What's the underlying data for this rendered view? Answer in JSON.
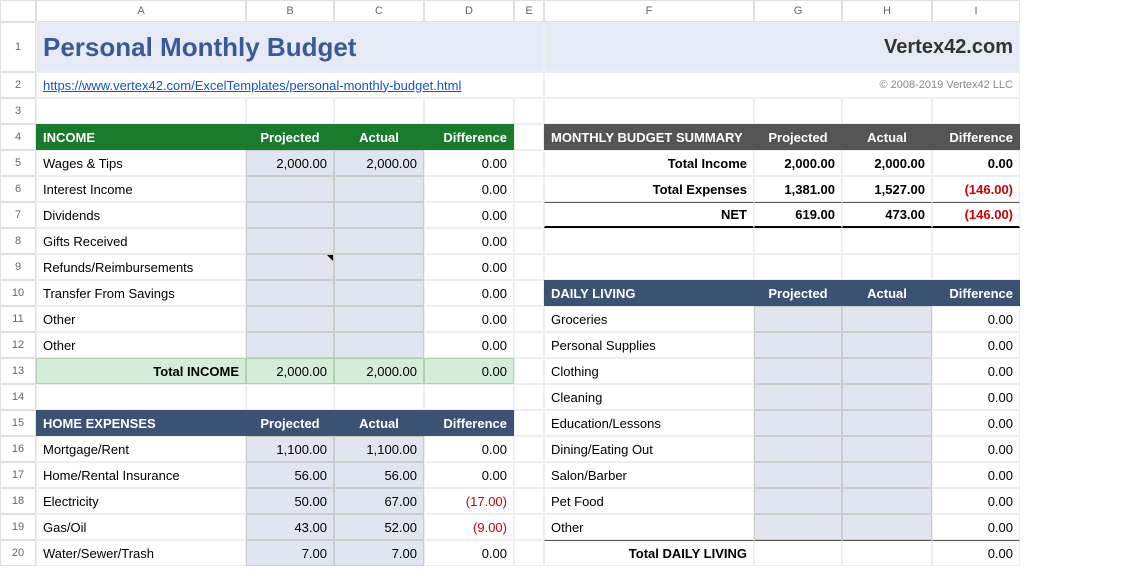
{
  "cols": [
    "A",
    "B",
    "C",
    "D",
    "E",
    "F",
    "G",
    "H",
    "I"
  ],
  "rows": [
    "1",
    "2",
    "3",
    "4",
    "5",
    "6",
    "7",
    "8",
    "9",
    "10",
    "11",
    "12",
    "13",
    "14",
    "15",
    "16",
    "17",
    "18",
    "19",
    "20"
  ],
  "title": "Personal Monthly Budget",
  "brand": "Vertex42.com",
  "link": "https://www.vertex42.com/ExcelTemplates/personal-monthly-budget.html",
  "copyright": "© 2008-2019 Vertex42 LLC",
  "headers": {
    "income": "INCOME",
    "projected": "Projected",
    "actual": "Actual",
    "difference": "Difference",
    "summary": "MONTHLY BUDGET SUMMARY",
    "home": "HOME EXPENSES",
    "daily": "DAILY LIVING"
  },
  "income": {
    "items": [
      {
        "label": "Wages & Tips",
        "proj": "2,000.00",
        "act": "2,000.00",
        "diff": "0.00"
      },
      {
        "label": "Interest Income",
        "proj": "",
        "act": "",
        "diff": "0.00"
      },
      {
        "label": "Dividends",
        "proj": "",
        "act": "",
        "diff": "0.00"
      },
      {
        "label": "Gifts Received",
        "proj": "",
        "act": "",
        "diff": "0.00"
      },
      {
        "label": "Refunds/Reimbursements",
        "proj": "",
        "act": "",
        "diff": "0.00"
      },
      {
        "label": "Transfer From Savings",
        "proj": "",
        "act": "",
        "diff": "0.00"
      },
      {
        "label": "Other",
        "proj": "",
        "act": "",
        "diff": "0.00"
      },
      {
        "label": "Other",
        "proj": "",
        "act": "",
        "diff": "0.00"
      }
    ],
    "total_label": "Total INCOME",
    "total_proj": "2,000.00",
    "total_act": "2,000.00",
    "total_diff": "0.00"
  },
  "summary": {
    "rows": [
      {
        "label": "Total Income",
        "proj": "2,000.00",
        "act": "2,000.00",
        "diff": "0.00",
        "neg": false
      },
      {
        "label": "Total Expenses",
        "proj": "1,381.00",
        "act": "1,527.00",
        "diff": "(146.00)",
        "neg": true
      },
      {
        "label": "NET",
        "proj": "619.00",
        "act": "473.00",
        "diff": "(146.00)",
        "neg": true
      }
    ]
  },
  "home": {
    "items": [
      {
        "label": "Mortgage/Rent",
        "proj": "1,100.00",
        "act": "1,100.00",
        "diff": "0.00",
        "neg": false
      },
      {
        "label": "Home/Rental Insurance",
        "proj": "56.00",
        "act": "56.00",
        "diff": "0.00",
        "neg": false
      },
      {
        "label": "Electricity",
        "proj": "50.00",
        "act": "67.00",
        "diff": "(17.00)",
        "neg": true
      },
      {
        "label": "Gas/Oil",
        "proj": "43.00",
        "act": "52.00",
        "diff": "(9.00)",
        "neg": true
      },
      {
        "label": "Water/Sewer/Trash",
        "proj": "7.00",
        "act": "7.00",
        "diff": "0.00",
        "neg": false
      }
    ]
  },
  "daily": {
    "items": [
      {
        "label": "Groceries",
        "diff": "0.00"
      },
      {
        "label": "Personal Supplies",
        "diff": "0.00"
      },
      {
        "label": "Clothing",
        "diff": "0.00"
      },
      {
        "label": "Cleaning",
        "diff": "0.00"
      },
      {
        "label": "Education/Lessons",
        "diff": "0.00"
      },
      {
        "label": "Dining/Eating Out",
        "diff": "0.00"
      },
      {
        "label": "Salon/Barber",
        "diff": "0.00"
      },
      {
        "label": "Pet Food",
        "diff": "0.00"
      },
      {
        "label": "Other",
        "diff": "0.00"
      }
    ],
    "total_label": "Total DAILY LIVING",
    "total_diff": "0.00"
  }
}
